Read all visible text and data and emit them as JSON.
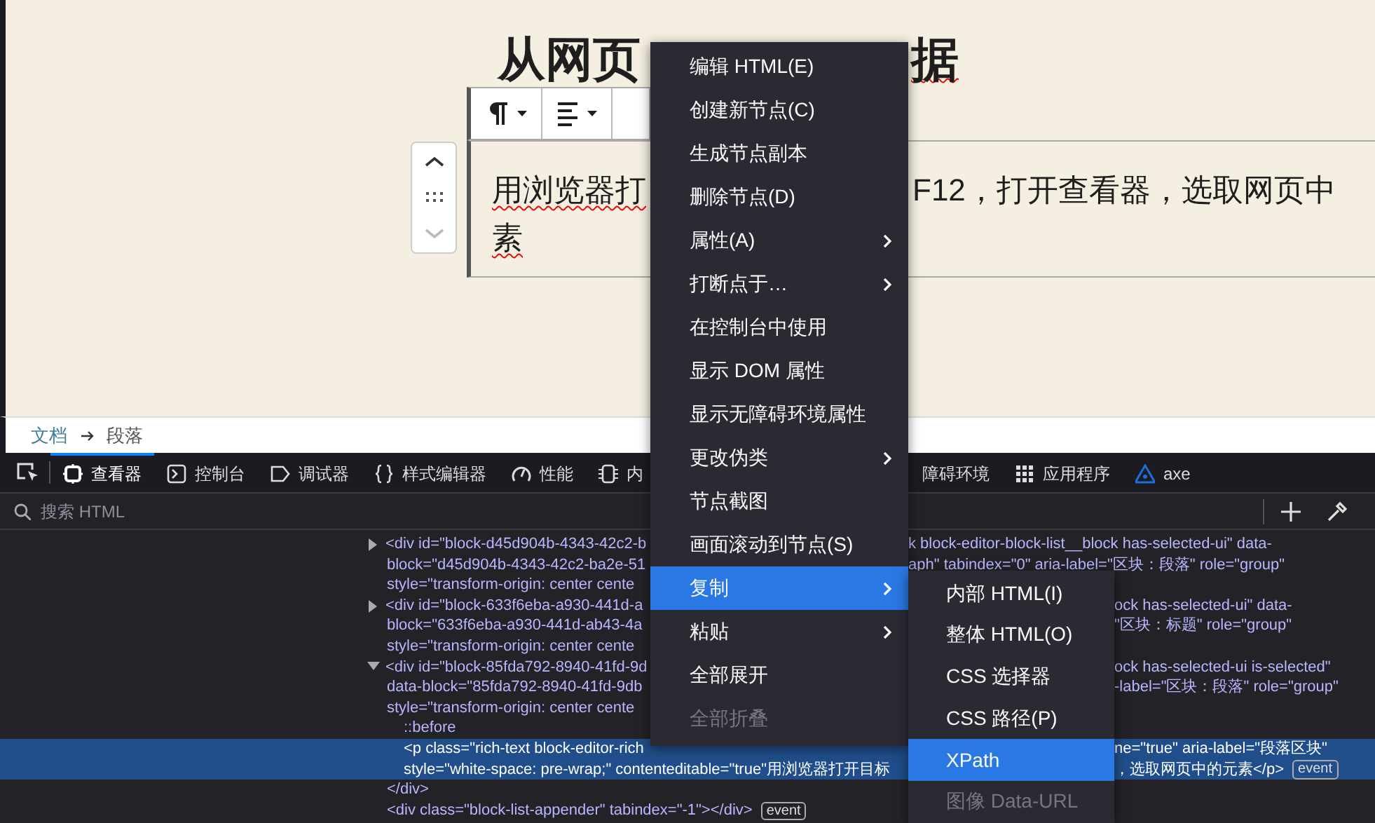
{
  "editor": {
    "heading_parts": [
      "从网页",
      "据"
    ],
    "toolbar": [
      {
        "kind": "paragraph"
      },
      {
        "kind": "align"
      }
    ],
    "paragraph_parts": [
      "用浏览器打",
      "F12，打开查看器，选取网页中",
      "素"
    ]
  },
  "breadcrumb": [
    "文档",
    "段落"
  ],
  "devtools": {
    "tabs": [
      {
        "label": "查看器",
        "kind": "inspector",
        "selected": true
      },
      {
        "label": "控制台",
        "kind": "console",
        "selected": false
      },
      {
        "label": "调试器",
        "kind": "debugger",
        "selected": false
      },
      {
        "label": "样式编辑器",
        "kind": "styles",
        "selected": false
      },
      {
        "label": "性能",
        "kind": "performance",
        "selected": false
      },
      {
        "label": "内",
        "kind": "memory",
        "selected": false
      },
      {
        "label": "障碍环境",
        "kind": "accessibility",
        "selected": false
      },
      {
        "label": "应用程序",
        "kind": "application",
        "selected": false
      },
      {
        "label": "axe",
        "kind": "axe",
        "selected": false
      }
    ],
    "search": {
      "placeholder": "搜索 HTML"
    },
    "tree": [
      {
        "expanded": false,
        "selected": false,
        "lines": [
          {
            "left": "<div id=\"block-d45d904b-4343-42c2-b",
            "right": "k block-editor-block-list__block has-selected-ui\" data-"
          },
          {
            "left": "block=\"d45d904b-4343-42c2-ba2e-51",
            "right": "aph\" tabindex=\"0\" aria-label=\"区块：段落\" role=\"group\""
          },
          {
            "left": "style=\"transform-origin: center cente"
          }
        ]
      },
      {
        "expanded": false,
        "selected": false,
        "lines": [
          {
            "left": "<div id=\"block-633f6eba-a930-441d-a",
            "right": "ock has-selected-ui\" data-"
          },
          {
            "left": "block=\"633f6eba-a930-441d-ab43-4a",
            "right": "\"区块：标题\" role=\"group\""
          },
          {
            "left": "style=\"transform-origin: center cente"
          }
        ]
      },
      {
        "expanded": true,
        "selected": false,
        "lines": [
          {
            "left": "<div id=\"block-85fda792-8940-41fd-9d",
            "right": "ock has-selected-ui is-selected\""
          },
          {
            "left": "data-block=\"85fda792-8940-41fd-9db",
            "right": "-label=\"区块：段落\" role=\"group\""
          },
          {
            "left": "style=\"transform-origin: center cente"
          }
        ],
        "children": [
          {
            "selected": false,
            "lines": [
              {
                "left": "::before"
              }
            ]
          },
          {
            "selected": true,
            "lines": [
              {
                "left": "<p class=\"rich-text block-editor-rich",
                "right": "ne=\"true\" aria-label=\"段落区块\""
              },
              {
                "left": "style=\"white-space: pre-wrap;\" contenteditable=\"true\"用浏览器打开目标",
                "right": "，选取网页中的元素</p>",
                "badge": "event"
              }
            ]
          }
        ],
        "closing": "</div>"
      },
      {
        "selected": false,
        "lines": [
          {
            "left": "<div class=\"block-list-appender\" tabindex=\"-1\"></div>",
            "badge": "event"
          }
        ]
      }
    ]
  },
  "context_menu": [
    {
      "label": "编辑 HTML(E)",
      "has_submenu": false,
      "selected": false,
      "disabled": false
    },
    {
      "label": "创建新节点(C)",
      "has_submenu": false,
      "selected": false,
      "disabled": false
    },
    {
      "label": "生成节点副本",
      "has_submenu": false,
      "selected": false,
      "disabled": false
    },
    {
      "label": "删除节点(D)",
      "has_submenu": false,
      "selected": false,
      "disabled": false
    },
    {
      "label": "属性(A)",
      "has_submenu": true,
      "selected": false,
      "disabled": false
    },
    {
      "label": "打断点于…",
      "has_submenu": true,
      "selected": false,
      "disabled": false
    },
    {
      "label": "在控制台中使用",
      "has_submenu": false,
      "selected": false,
      "disabled": false
    },
    {
      "label": "显示 DOM 属性",
      "has_submenu": false,
      "selected": false,
      "disabled": false
    },
    {
      "label": "显示无障碍环境属性",
      "has_submenu": false,
      "selected": false,
      "disabled": false
    },
    {
      "label": "更改伪类",
      "has_submenu": true,
      "selected": false,
      "disabled": false
    },
    {
      "label": "节点截图",
      "has_submenu": false,
      "selected": false,
      "disabled": false
    },
    {
      "label": "画面滚动到节点(S)",
      "has_submenu": false,
      "selected": false,
      "disabled": false
    },
    {
      "label": "复制",
      "has_submenu": true,
      "selected": true,
      "disabled": false
    },
    {
      "label": "粘贴",
      "has_submenu": true,
      "selected": false,
      "disabled": false
    },
    {
      "label": "全部展开",
      "has_submenu": false,
      "selected": false,
      "disabled": false
    },
    {
      "label": "全部折叠",
      "has_submenu": false,
      "selected": false,
      "disabled": true
    }
  ],
  "copy_submenu": [
    {
      "label": "内部 HTML(I)",
      "has_submenu": false,
      "selected": false,
      "disabled": false
    },
    {
      "label": "整体 HTML(O)",
      "has_submenu": false,
      "selected": false,
      "disabled": false
    },
    {
      "label": "CSS 选择器",
      "has_submenu": false,
      "selected": false,
      "disabled": false
    },
    {
      "label": "CSS 路径(P)",
      "has_submenu": false,
      "selected": false,
      "disabled": false
    },
    {
      "label": "XPath",
      "has_submenu": false,
      "selected": true,
      "disabled": false
    },
    {
      "label": "图像 Data-URL",
      "has_submenu": false,
      "selected": false,
      "disabled": true
    }
  ]
}
